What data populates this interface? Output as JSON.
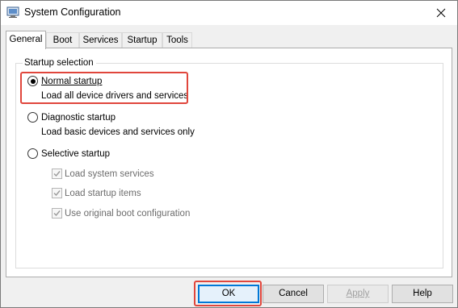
{
  "window": {
    "title": "System Configuration",
    "app_icon": "msconfig-icon",
    "close_glyph": "✕"
  },
  "tabs": [
    {
      "label": "General",
      "active": true
    },
    {
      "label": "Boot",
      "active": false
    },
    {
      "label": "Services",
      "active": false
    },
    {
      "label": "Startup",
      "active": false
    },
    {
      "label": "Tools",
      "active": false
    }
  ],
  "startup_selection": {
    "group_label": "Startup selection",
    "normal": {
      "label": "Normal startup",
      "description": "Load all device drivers and services",
      "selected": true
    },
    "diagnostic": {
      "label": "Diagnostic startup",
      "description": "Load basic devices and services only",
      "selected": false
    },
    "selective": {
      "label": "Selective startup",
      "selected": false,
      "options": [
        {
          "label": "Load system services",
          "checked": true,
          "enabled": false
        },
        {
          "label": "Load startup items",
          "checked": true,
          "enabled": false
        },
        {
          "label": "Use original boot configuration",
          "checked": true,
          "enabled": false
        }
      ]
    }
  },
  "buttons": {
    "ok": "OK",
    "cancel": "Cancel",
    "apply": "Apply",
    "help": "Help"
  },
  "colors": {
    "highlight": "#e0463c",
    "accent": "#0078d7"
  }
}
